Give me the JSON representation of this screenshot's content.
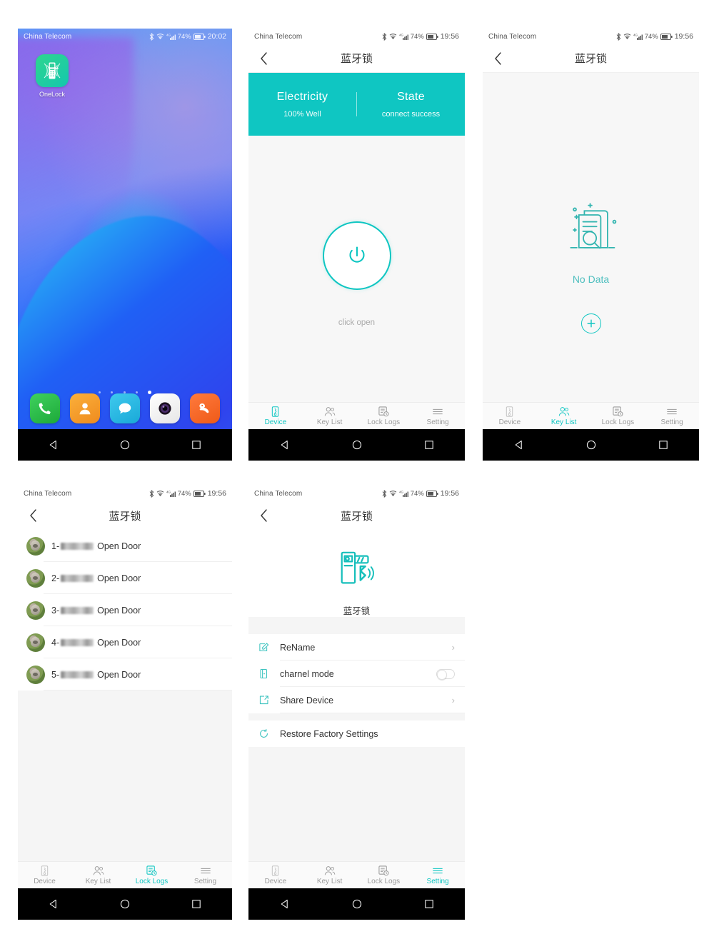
{
  "theme": {
    "accent": "#0FC6C2",
    "muted": "#9B9B9B",
    "dark": "#333333"
  },
  "status_bar": {
    "carrier": "China Telecom",
    "battery_percent": "74%",
    "time_home": "20:02",
    "time_app": "19:56"
  },
  "home_screen": {
    "app_icon_label": "OneLock",
    "dock": [
      {
        "name": "phone",
        "color": "#2ab44a"
      },
      {
        "name": "contacts",
        "color": "#f2982c"
      },
      {
        "name": "messages",
        "color": "#23b6e0"
      },
      {
        "name": "camera",
        "color": "#f4f4f4"
      },
      {
        "name": "uc-browser",
        "color": "#f4622b"
      }
    ],
    "page_dots": 5,
    "active_dot": 5
  },
  "device_screen": {
    "title": "蓝牙锁",
    "banner": {
      "electricity_label": "Electricity",
      "electricity_value": "100% Well",
      "state_label": "State",
      "state_value": "connect success"
    },
    "power_caption": "click open"
  },
  "key_list_screen": {
    "title": "蓝牙锁",
    "empty_text": "No Data",
    "add_button_label": "+"
  },
  "lock_logs_screen": {
    "title": "蓝牙锁",
    "rows": [
      {
        "index": "1-",
        "action": "Open Door"
      },
      {
        "index": "2-",
        "action": "Open Door"
      },
      {
        "index": "3-",
        "action": "Open Door"
      },
      {
        "index": "4-",
        "action": "Open Door"
      },
      {
        "index": "5-",
        "action": "Open Door"
      }
    ]
  },
  "setting_screen": {
    "title": "蓝牙锁",
    "device_name": "蓝牙锁",
    "items": [
      {
        "label": "ReName",
        "icon": "edit-icon",
        "control": "chevron"
      },
      {
        "label": "charnel mode",
        "icon": "door-icon",
        "control": "toggle",
        "toggle_on": false
      },
      {
        "label": "Share Device",
        "icon": "share-icon",
        "control": "chevron"
      },
      {
        "label": "Restore Factory Settings",
        "icon": "refresh-icon",
        "control": "none"
      }
    ],
    "chevron_glyph": "›"
  },
  "tabbar": {
    "tabs": [
      {
        "label": "Device",
        "icon": "device-lock-icon"
      },
      {
        "label": "Key List",
        "icon": "people-icon"
      },
      {
        "label": "Lock Logs",
        "icon": "log-clock-icon"
      },
      {
        "label": "Setting",
        "icon": "menu-lines-icon"
      }
    ]
  },
  "android_nav": {
    "back": "back-triangle-icon",
    "home": "home-circle-icon",
    "recents": "recents-square-icon"
  }
}
